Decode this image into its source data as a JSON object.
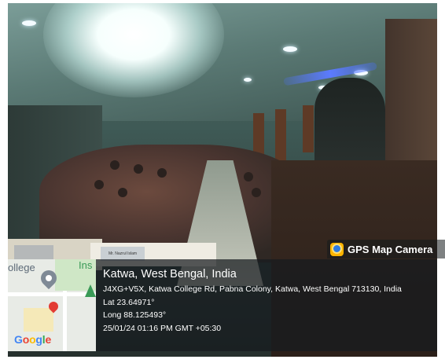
{
  "overlay": {
    "app_name": "GPS Map Camera",
    "app_icon": "gps-map-camera-icon",
    "location_title": "Katwa, West Bengal, India",
    "address": "J4XG+V5X, Katwa College Rd, Pabna Colony, Katwa, West Bengal 713130, India",
    "latitude": "Lat 23.64971°",
    "longitude": "Long 88.125493°",
    "timestamp": "25/01/24 01:16 PM GMT +05:30"
  },
  "map": {
    "label_left": "ollege",
    "label_right": "Ins",
    "logo_letters": [
      "G",
      "o",
      "o",
      "g",
      "l",
      "e"
    ],
    "pin_colors": {
      "place": "#7f8a96",
      "green": "#3a9a57",
      "current": "#e23b33"
    }
  },
  "scene": {
    "nameplate_text": "Mr. Nazrul Islam",
    "description_colors": {
      "podium": "#2b1f19",
      "glare": "#ffffff"
    }
  }
}
